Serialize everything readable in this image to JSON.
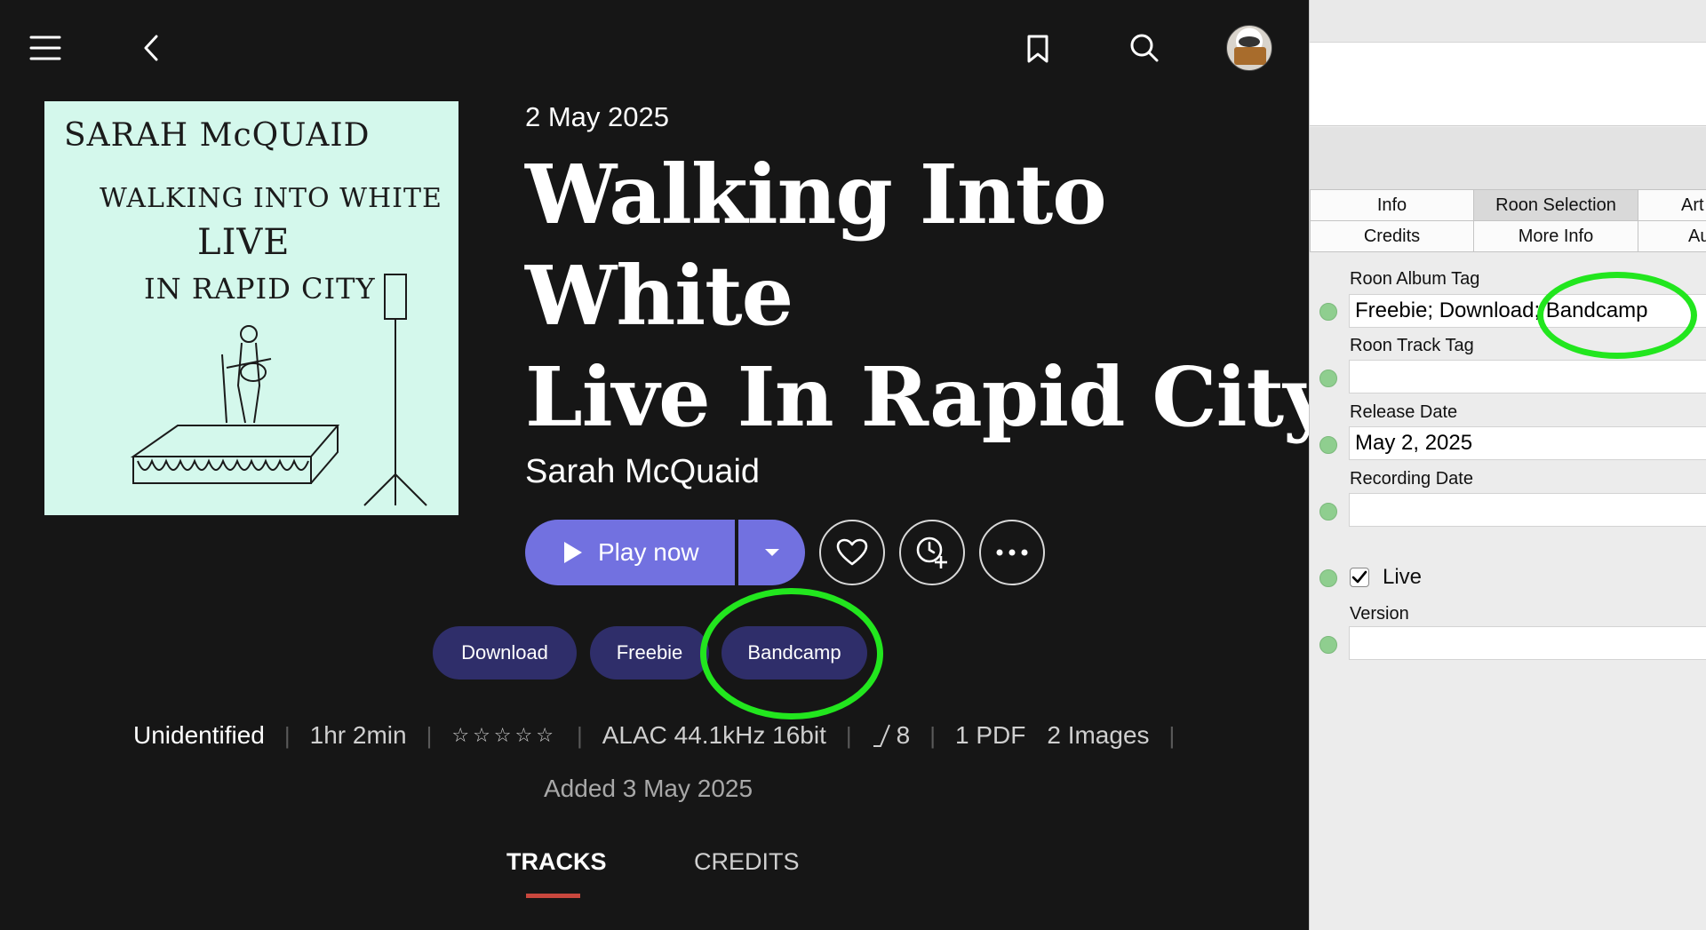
{
  "roon": {
    "release_date": "2 May 2025",
    "title_lines": [
      "Walking Into",
      "White",
      "Live In Rapid City"
    ],
    "artist": "Sarah McQuaid",
    "cover": {
      "line1": "SARAH McQUAID",
      "line2": "WALKING INTO WHITE",
      "line3": "LIVE",
      "line4": "IN RAPID CITY"
    },
    "play_label": "Play now",
    "tags": [
      "Download",
      "Freebie",
      "Bandcamp"
    ],
    "meta": {
      "status": "Unidentified",
      "duration": "1hr 2min",
      "stars": "☆☆☆☆☆",
      "format": "ALAC 44.1kHz 16bit",
      "versions": "8",
      "pdf": "1 PDF",
      "images": "2 Images"
    },
    "added": "Added 3 May 2025",
    "tabs": [
      "TRACKS",
      "CREDITS"
    ]
  },
  "editor": {
    "tabs_row1": [
      "Info",
      "Roon Selection",
      "Art"
    ],
    "tabs_row2": [
      "Credits",
      "More Info",
      "Au"
    ],
    "fields": {
      "album_tag_label": "Roon Album Tag",
      "album_tag_value": "Freebie; Download; Bandcamp",
      "track_tag_label": "Roon Track Tag",
      "track_tag_value": "",
      "release_date_label": "Release Date",
      "release_date_value": "May 2, 2025",
      "recording_date_label": "Recording Date",
      "recording_date_value": "",
      "live_label": "Live",
      "version_label": "Version",
      "version_value": ""
    }
  },
  "colors": {
    "play_button": "#7271e0",
    "tag_pill": "#2f2e6a",
    "highlight": "#22e61e",
    "tab_underline": "#c9473d"
  }
}
